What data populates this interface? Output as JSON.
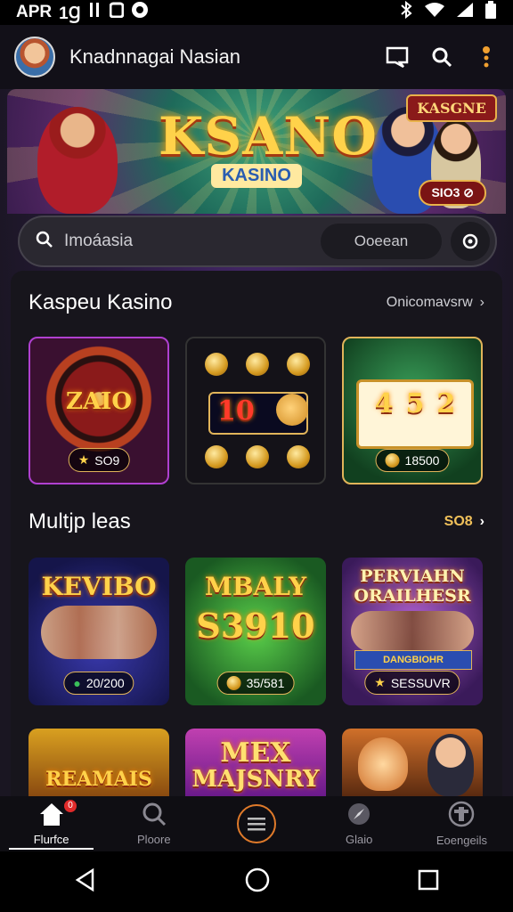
{
  "status_bar": {
    "time": "APR",
    "date_code": "1Ɡ",
    "icons": [
      "notification-icon",
      "clipboard-icon",
      "media-icon"
    ],
    "right_icons": [
      "bluetooth-icon",
      "wifi-icon",
      "signal-icon",
      "battery-icon"
    ]
  },
  "app_bar": {
    "title": "Knadnnagai Nasian",
    "icons": [
      "chat-icon",
      "search-icon",
      "more-icon"
    ]
  },
  "banner": {
    "logo_main": "KSANO",
    "logo_sub": "KASINO",
    "chip_top": "KASGNE",
    "chip_bottom": "SIO3 ⊘"
  },
  "search": {
    "placeholder": "Imoáasia",
    "chip": "Ooeean"
  },
  "section1": {
    "title": "Kaspeu Kasino",
    "more": "Onicomavsrw",
    "tiles": [
      {
        "name": "roulette",
        "title": "ZAIO",
        "label": "SO9"
      },
      {
        "name": "slots-dark",
        "title": "10",
        "label": ""
      },
      {
        "name": "slots-green",
        "title": "452",
        "label": "18500"
      }
    ]
  },
  "section2": {
    "title": "Multjp leas",
    "more": "SO8",
    "tiles": [
      {
        "name": "kevibo",
        "title": "KEVIBO",
        "label": "20/200"
      },
      {
        "name": "mbaly",
        "title": "MBALY",
        "subtitle": "S3910",
        "label": "35/581"
      },
      {
        "name": "pervianh",
        "title": "PERVIAHN",
        "subtitle": "ORAILHESR",
        "ribbon": "DANGBIOHR",
        "label": "SESSUVR"
      }
    ]
  },
  "section3": {
    "tiles": [
      {
        "name": "reamais",
        "title": "REAMAIS"
      },
      {
        "name": "mex-majsnry",
        "title": "MEX",
        "subtitle": "MAJSNRY"
      },
      {
        "name": "fox-game",
        "title": ""
      }
    ]
  },
  "bottom_nav": [
    {
      "label": "Flurfce",
      "icon": "home-icon",
      "active": true,
      "badge": "0"
    },
    {
      "label": "Ploore",
      "icon": "search-icon",
      "active": false
    },
    {
      "label": "",
      "icon": "menu-icon",
      "active": false
    },
    {
      "label": "Glaio",
      "icon": "compass-icon",
      "active": false
    },
    {
      "label": "Eoengeils",
      "icon": "profile-icon",
      "active": false
    }
  ],
  "colors": {
    "accent": "#e1b45a",
    "background": "#1a1622",
    "active_nav": "#ffffff",
    "badge": "#e02a2a"
  }
}
